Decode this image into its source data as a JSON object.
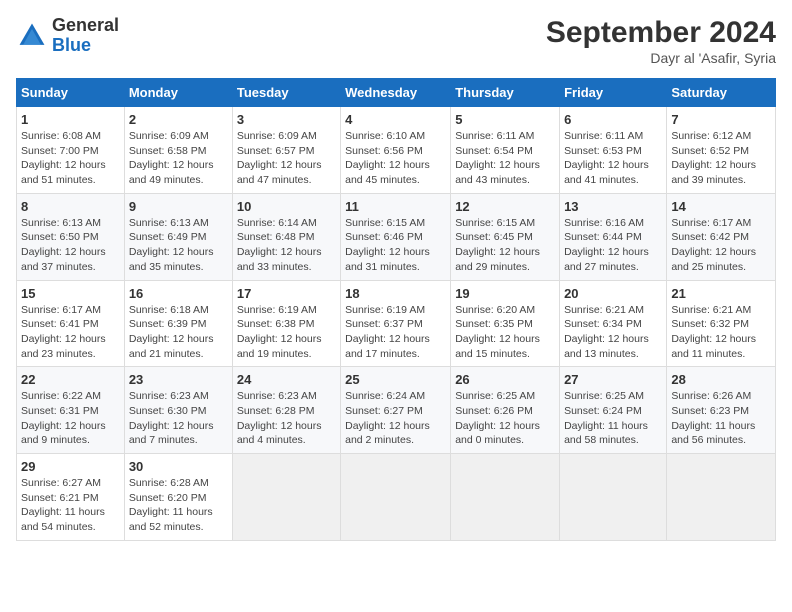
{
  "header": {
    "logo_line1": "General",
    "logo_line2": "Blue",
    "month": "September 2024",
    "location": "Dayr al 'Asafir, Syria"
  },
  "weekdays": [
    "Sunday",
    "Monday",
    "Tuesday",
    "Wednesday",
    "Thursday",
    "Friday",
    "Saturday"
  ],
  "weeks": [
    [
      {
        "day": "1",
        "sunrise": "6:08 AM",
        "sunset": "7:00 PM",
        "daylight": "12 hours and 51 minutes."
      },
      {
        "day": "2",
        "sunrise": "6:09 AM",
        "sunset": "6:58 PM",
        "daylight": "12 hours and 49 minutes."
      },
      {
        "day": "3",
        "sunrise": "6:09 AM",
        "sunset": "6:57 PM",
        "daylight": "12 hours and 47 minutes."
      },
      {
        "day": "4",
        "sunrise": "6:10 AM",
        "sunset": "6:56 PM",
        "daylight": "12 hours and 45 minutes."
      },
      {
        "day": "5",
        "sunrise": "6:11 AM",
        "sunset": "6:54 PM",
        "daylight": "12 hours and 43 minutes."
      },
      {
        "day": "6",
        "sunrise": "6:11 AM",
        "sunset": "6:53 PM",
        "daylight": "12 hours and 41 minutes."
      },
      {
        "day": "7",
        "sunrise": "6:12 AM",
        "sunset": "6:52 PM",
        "daylight": "12 hours and 39 minutes."
      }
    ],
    [
      {
        "day": "8",
        "sunrise": "6:13 AM",
        "sunset": "6:50 PM",
        "daylight": "12 hours and 37 minutes."
      },
      {
        "day": "9",
        "sunrise": "6:13 AM",
        "sunset": "6:49 PM",
        "daylight": "12 hours and 35 minutes."
      },
      {
        "day": "10",
        "sunrise": "6:14 AM",
        "sunset": "6:48 PM",
        "daylight": "12 hours and 33 minutes."
      },
      {
        "day": "11",
        "sunrise": "6:15 AM",
        "sunset": "6:46 PM",
        "daylight": "12 hours and 31 minutes."
      },
      {
        "day": "12",
        "sunrise": "6:15 AM",
        "sunset": "6:45 PM",
        "daylight": "12 hours and 29 minutes."
      },
      {
        "day": "13",
        "sunrise": "6:16 AM",
        "sunset": "6:44 PM",
        "daylight": "12 hours and 27 minutes."
      },
      {
        "day": "14",
        "sunrise": "6:17 AM",
        "sunset": "6:42 PM",
        "daylight": "12 hours and 25 minutes."
      }
    ],
    [
      {
        "day": "15",
        "sunrise": "6:17 AM",
        "sunset": "6:41 PM",
        "daylight": "12 hours and 23 minutes."
      },
      {
        "day": "16",
        "sunrise": "6:18 AM",
        "sunset": "6:39 PM",
        "daylight": "12 hours and 21 minutes."
      },
      {
        "day": "17",
        "sunrise": "6:19 AM",
        "sunset": "6:38 PM",
        "daylight": "12 hours and 19 minutes."
      },
      {
        "day": "18",
        "sunrise": "6:19 AM",
        "sunset": "6:37 PM",
        "daylight": "12 hours and 17 minutes."
      },
      {
        "day": "19",
        "sunrise": "6:20 AM",
        "sunset": "6:35 PM",
        "daylight": "12 hours and 15 minutes."
      },
      {
        "day": "20",
        "sunrise": "6:21 AM",
        "sunset": "6:34 PM",
        "daylight": "12 hours and 13 minutes."
      },
      {
        "day": "21",
        "sunrise": "6:21 AM",
        "sunset": "6:32 PM",
        "daylight": "12 hours and 11 minutes."
      }
    ],
    [
      {
        "day": "22",
        "sunrise": "6:22 AM",
        "sunset": "6:31 PM",
        "daylight": "12 hours and 9 minutes."
      },
      {
        "day": "23",
        "sunrise": "6:23 AM",
        "sunset": "6:30 PM",
        "daylight": "12 hours and 7 minutes."
      },
      {
        "day": "24",
        "sunrise": "6:23 AM",
        "sunset": "6:28 PM",
        "daylight": "12 hours and 4 minutes."
      },
      {
        "day": "25",
        "sunrise": "6:24 AM",
        "sunset": "6:27 PM",
        "daylight": "12 hours and 2 minutes."
      },
      {
        "day": "26",
        "sunrise": "6:25 AM",
        "sunset": "6:26 PM",
        "daylight": "12 hours and 0 minutes."
      },
      {
        "day": "27",
        "sunrise": "6:25 AM",
        "sunset": "6:24 PM",
        "daylight": "11 hours and 58 minutes."
      },
      {
        "day": "28",
        "sunrise": "6:26 AM",
        "sunset": "6:23 PM",
        "daylight": "11 hours and 56 minutes."
      }
    ],
    [
      {
        "day": "29",
        "sunrise": "6:27 AM",
        "sunset": "6:21 PM",
        "daylight": "11 hours and 54 minutes."
      },
      {
        "day": "30",
        "sunrise": "6:28 AM",
        "sunset": "6:20 PM",
        "daylight": "11 hours and 52 minutes."
      },
      null,
      null,
      null,
      null,
      null
    ]
  ]
}
